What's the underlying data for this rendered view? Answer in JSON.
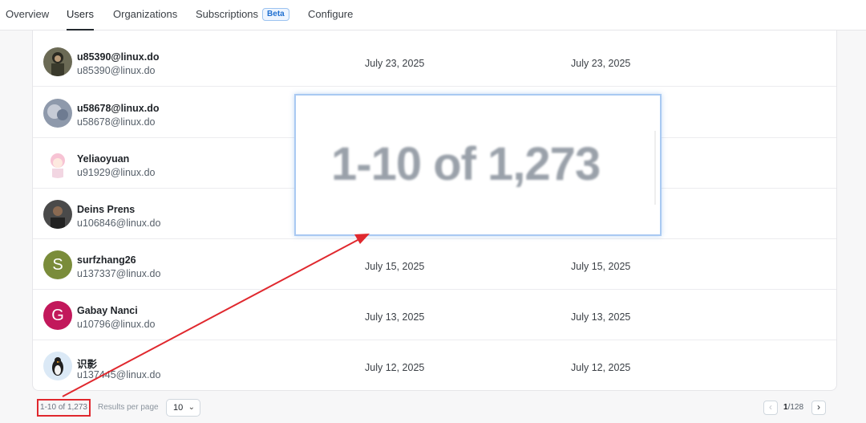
{
  "nav": {
    "tabs": [
      {
        "label": "Overview"
      },
      {
        "label": "Users"
      },
      {
        "label": "Organizations"
      },
      {
        "label": "Subscriptions",
        "badge": "Beta"
      },
      {
        "label": "Configure"
      }
    ],
    "active_tab": "Users"
  },
  "users": [
    {
      "name": "u85390@linux.do",
      "email": "u85390@linux.do",
      "date1": "July 23, 2025",
      "date2": "July 23, 2025",
      "avatar": "photo"
    },
    {
      "name": "u58678@linux.do",
      "email": "u58678@linux.do",
      "date1": "",
      "date2": "",
      "avatar": "photo"
    },
    {
      "name": "Yeliaoyuan",
      "email": "u91929@linux.do",
      "date1": "",
      "date2": "",
      "avatar": "anime"
    },
    {
      "name": "Deins Prens",
      "email": "u106846@linux.do",
      "date1": "",
      "date2": "",
      "avatar": "photo"
    },
    {
      "name": "surfzhang26",
      "email": "u137337@linux.do",
      "date1": "July 15, 2025",
      "date2": "July 15, 2025",
      "avatar": "S",
      "avatar_color": "#7a8c3a"
    },
    {
      "name": "Gabay Nanci",
      "email": "u10796@linux.do",
      "date1": "July 13, 2025",
      "date2": "July 13, 2025",
      "avatar": "G",
      "avatar_color": "#c2185b"
    },
    {
      "name": "识影",
      "email": "u137445@linux.do",
      "date1": "July 12, 2025",
      "date2": "July 12, 2025",
      "avatar": "penguin"
    }
  ],
  "pagination": {
    "count_text": "1-10 of 1,273",
    "results_per_page_label": "Results per page",
    "per_page_value": "10",
    "current_page": "1",
    "total_pages": "/128"
  },
  "zoom_callout": {
    "text": "1-10 of 1,273"
  },
  "colors": {
    "highlight_red": "#e0282e",
    "zoom_border": "#a9c9f2"
  }
}
